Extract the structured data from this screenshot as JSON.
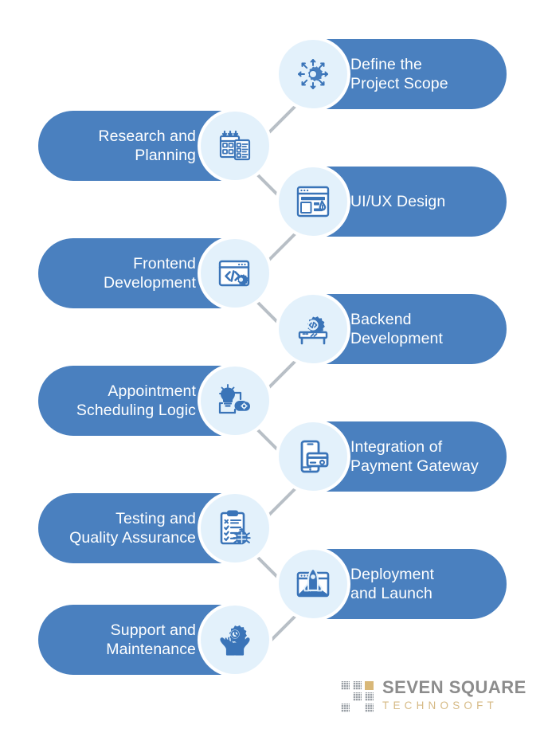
{
  "theme": {
    "background": "#ffffff",
    "pill_fill": "#4a80bf",
    "icon_circle_fill": "#e3f1fb",
    "icon_circle_ring": "#ffffff",
    "icon_stroke": "#3a74b8",
    "label_color": "#ffffff",
    "connector_color": "#b8bfc6",
    "logo_name_color": "#8c8c8c",
    "logo_sub_color": "#d6ba85",
    "logo_square_gray": "#9aa0a6",
    "logo_square_gold": "#d9b878"
  },
  "diagram": {
    "type": "zigzag-process-flow",
    "step_count": 10,
    "steps": [
      {
        "index": 1,
        "side": "right",
        "label": "Define the\nProject Scope",
        "icon": "scope-network-gear-icon"
      },
      {
        "index": 2,
        "side": "left",
        "label": "Research and\nPlanning",
        "icon": "calendar-checklist-icon"
      },
      {
        "index": 3,
        "side": "right",
        "label": "UI/UX Design",
        "icon": "browser-wireframe-pen-icon"
      },
      {
        "index": 4,
        "side": "left",
        "label": "Frontend\nDevelopment",
        "icon": "browser-code-gear-icon"
      },
      {
        "index": 5,
        "side": "right",
        "label": "Backend\nDevelopment",
        "icon": "server-code-gear-icon"
      },
      {
        "index": 6,
        "side": "left",
        "label": "Appointment\nScheduling Logic",
        "icon": "lightbulb-workflow-icon"
      },
      {
        "index": 7,
        "side": "right",
        "label": "Integration of\nPayment Gateway",
        "icon": "mobile-credit-card-icon"
      },
      {
        "index": 8,
        "side": "left",
        "label": "Testing and\nQuality Assurance",
        "icon": "checklist-bug-icon"
      },
      {
        "index": 9,
        "side": "right",
        "label": "Deployment\nand Launch",
        "icon": "rocket-browser-launch-icon"
      },
      {
        "index": 10,
        "side": "left",
        "label": "Support and\nMaintenance",
        "icon": "hands-gear-support-icon"
      }
    ]
  },
  "logo": {
    "name": "SEVEN SQUARE",
    "subtitle": "TECHNOSOFT",
    "mark": "nine-square-grid-icon"
  }
}
